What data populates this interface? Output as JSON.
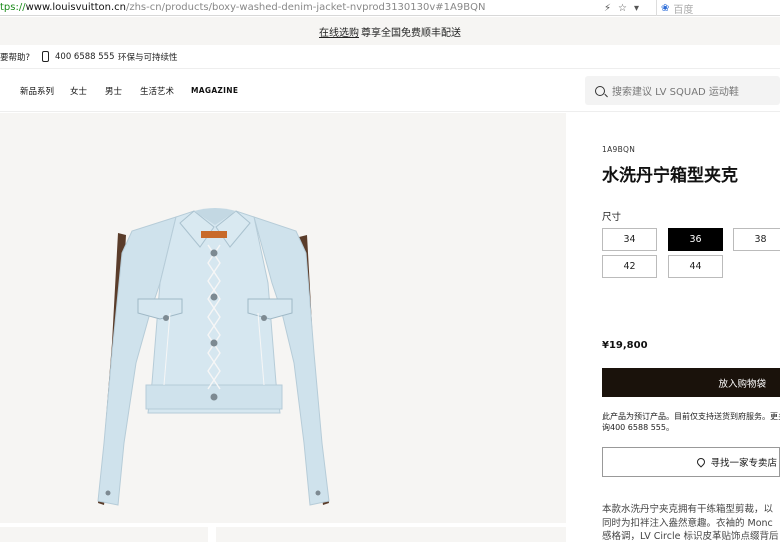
{
  "browser": {
    "url_protocol": "tps://",
    "url_host": "www.louisvuitton.cn",
    "url_path": "/zhs-cn/products/boxy-washed-denim-jacket-nvprod3130130v#1A9BQN",
    "search_placeholder": "百度",
    "icons": [
      "lightning-icon",
      "star-icon",
      "dropdown-icon"
    ]
  },
  "announcement": {
    "link": "在线选购",
    "text": "尊享全国免费顺丰配送"
  },
  "utility": {
    "help": "要帮助?",
    "phone": "400 6588 555",
    "sustainability": "环保与可持续性"
  },
  "nav": {
    "items": [
      "新品系列",
      "女士",
      "男士",
      "生活艺术",
      "MAGAZINE"
    ],
    "search_placeholder": "搜索建议  LV SQUAD 运动鞋"
  },
  "product": {
    "sku": "1A9BQN",
    "title": "水洗丹宁箱型夹克",
    "size_label": "尺寸",
    "sizes": [
      "34",
      "36",
      "38",
      "42",
      "44"
    ],
    "selected_size": "36",
    "price": "¥19,800",
    "add_to_cart": "放入购物袋",
    "notice_line1": "此产品为预订产品。目前仅支持送货到府服务。更多",
    "notice_line2": "询400 6588 555。",
    "find_store": "寻找一家专卖店",
    "desc_line1": "本款水洗丹宁夹克拥有干练箱型剪裁，以",
    "desc_line2": "同时为扣袢注入盎然意趣。衣袖的 Monc",
    "desc_line3": "感格调，LV Circle 标识皮革贴饰点缀背后"
  },
  "colors": {
    "denim": "#cfe2ec",
    "cart_button": "#1a120b",
    "background_gallery": "#f6f5f3"
  }
}
